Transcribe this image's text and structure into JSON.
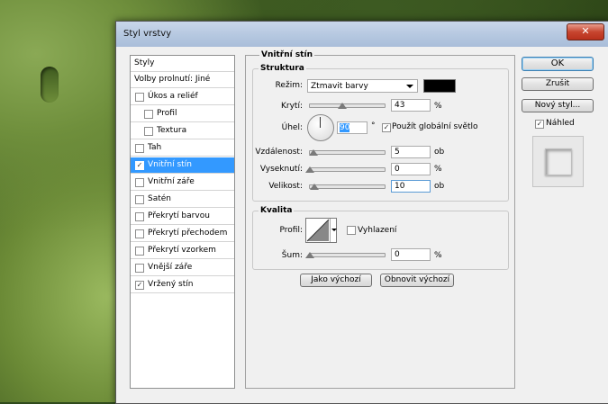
{
  "window": {
    "title": "Styl vrstvy",
    "close_label": "✕"
  },
  "sidebar": {
    "header": "Styly",
    "blend_options": "Volby prolnutí: Jiné",
    "items": [
      {
        "label": "Úkos a reliéf",
        "checked": false,
        "indent": false
      },
      {
        "label": "Profil",
        "checked": false,
        "indent": true
      },
      {
        "label": "Textura",
        "checked": false,
        "indent": true
      },
      {
        "label": "Tah",
        "checked": false,
        "indent": false
      },
      {
        "label": "Vnitřní stín",
        "checked": true,
        "indent": false,
        "selected": true
      },
      {
        "label": "Vnitřní záře",
        "checked": false,
        "indent": false
      },
      {
        "label": "Satén",
        "checked": false,
        "indent": false
      },
      {
        "label": "Překrytí barvou",
        "checked": false,
        "indent": false
      },
      {
        "label": "Překrytí přechodem",
        "checked": false,
        "indent": false
      },
      {
        "label": "Překrytí vzorkem",
        "checked": false,
        "indent": false
      },
      {
        "label": "Vnější záře",
        "checked": false,
        "indent": false
      },
      {
        "label": "Vržený stín",
        "checked": true,
        "indent": false
      }
    ]
  },
  "panel": {
    "title": "Vnitřní stín",
    "structure": {
      "title": "Struktura",
      "mode_label": "Režim:",
      "mode_value": "Ztmavit barvy",
      "mode_color": "#000000",
      "opacity_label": "Krytí:",
      "opacity_value": "43",
      "opacity_unit": "%",
      "opacity_fraction": 0.43,
      "angle_label": "Úhel:",
      "angle_value": "90",
      "angle_unit": "°",
      "global_light_label": "Použít globální světlo",
      "global_light_checked": true,
      "distance_label": "Vzdálenost:",
      "distance_value": "5",
      "distance_unit": "ob",
      "choke_label": "Vyseknutí:",
      "choke_value": "0",
      "choke_unit": "%",
      "size_label": "Velikost:",
      "size_value": "10",
      "size_unit": "ob"
    },
    "quality": {
      "title": "Kvalita",
      "profile_label": "Profil:",
      "antialias_label": "Vyhlazení",
      "antialias_checked": false,
      "noise_label": "Šum:",
      "noise_value": "0",
      "noise_unit": "%"
    },
    "default_button": "Jako výchozí",
    "reset_button": "Obnovit výchozí"
  },
  "buttons": {
    "ok": "OK",
    "cancel": "Zrušit",
    "new_style": "Nový styl...",
    "preview_label": "Náhled",
    "preview_checked": true
  }
}
